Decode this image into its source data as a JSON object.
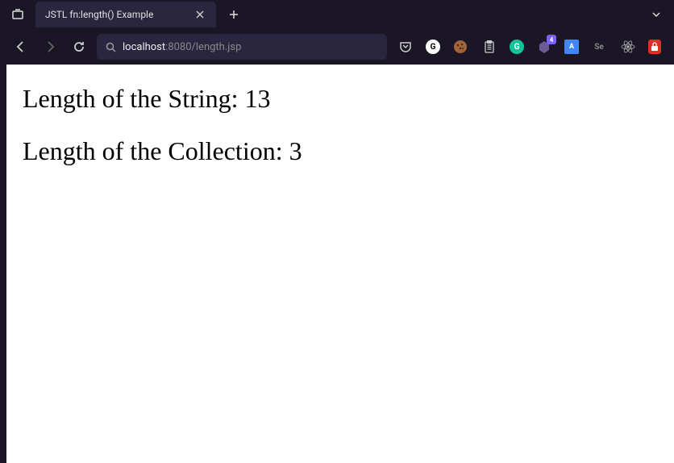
{
  "tab": {
    "title": "JSTL fn:length() Example"
  },
  "url": {
    "host": "localhost",
    "port": ":8080",
    "path": "/length.jsp"
  },
  "toolbar": {
    "badge_count": "4"
  },
  "page": {
    "heading1": "Length of the String: 13",
    "heading2": "Length of the Collection: 3"
  }
}
